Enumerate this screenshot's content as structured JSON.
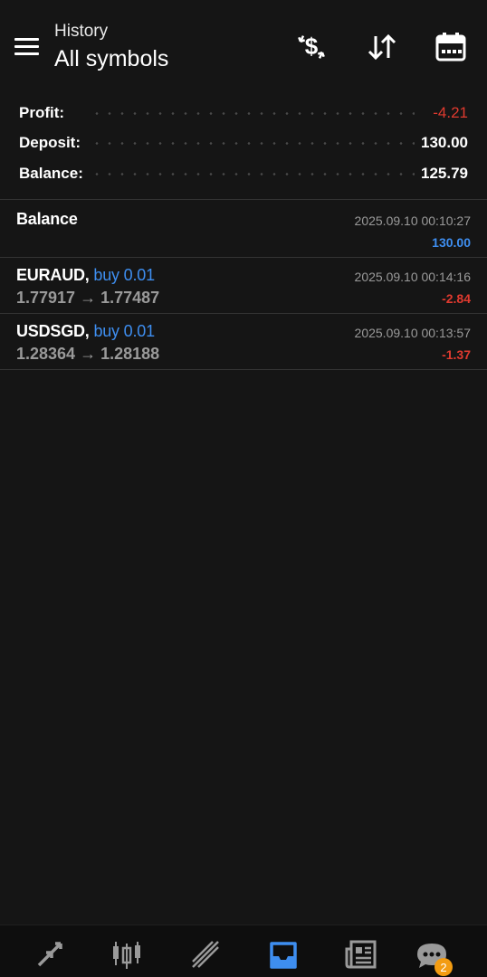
{
  "header": {
    "subtitle": "History",
    "title": "All symbols"
  },
  "summary": [
    {
      "label": "Profit:",
      "value": "-4.21",
      "negative": true
    },
    {
      "label": "Deposit:",
      "value": "130.00",
      "negative": false
    },
    {
      "label": "Balance:",
      "value": "125.79",
      "negative": false
    }
  ],
  "deals": [
    {
      "symbol": "Balance",
      "type": "",
      "prices": "",
      "time": "2025.09.10 00:10:27",
      "amount": "130.00",
      "amount_color": "#3e8ef0"
    },
    {
      "symbol": "EURAUD,",
      "type": "buy 0.01",
      "prices": "1.77917 → 1.77487",
      "time": "2025.09.10 00:14:16",
      "amount": "-2.84",
      "amount_color": "#e03a2f"
    },
    {
      "symbol": "USDSGD,",
      "type": "buy 0.01",
      "prices": "1.28364 → 1.28188",
      "time": "2025.09.10 00:13:57",
      "amount": "-1.37",
      "amount_color": "#e03a2f"
    }
  ],
  "bottom_nav": {
    "items": [
      "quotes-icon",
      "chart-icon",
      "trade-icon",
      "history-icon",
      "news-icon",
      "chat-icon"
    ],
    "active": "history-icon",
    "chat_badge": "2"
  },
  "colors": {
    "background": "#151515",
    "accent": "#3e8ef0",
    "negative": "#e03a2f",
    "badge": "#f39c12"
  }
}
